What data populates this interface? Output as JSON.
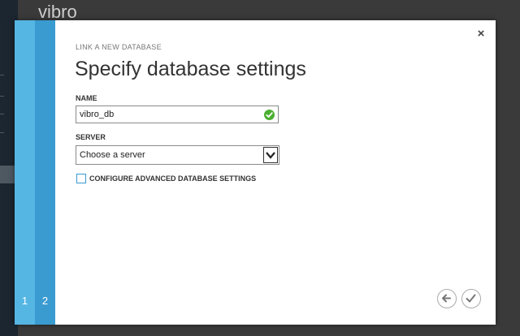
{
  "background": {
    "app_title": "vibro"
  },
  "dialog": {
    "steps": [
      "1",
      "2"
    ],
    "subtitle": "LINK A NEW DATABASE",
    "heading": "Specify database settings",
    "name_label": "NAME",
    "name_value": "vibro_db",
    "server_label": "SERVER",
    "server_value": "Choose a server",
    "advanced_checkbox_label": "CONFIGURE ADVANCED DATABASE SETTINGS",
    "advanced_checked": false,
    "close_glyph": "×"
  },
  "colors": {
    "step1": "#55b6e4",
    "step2": "#3a9bd0",
    "valid": "#4caf32"
  },
  "icons": {
    "close": "close-icon",
    "valid": "check-circle-icon",
    "dropdown": "chevron-down-icon",
    "back": "arrow-left-icon",
    "finish": "checkmark-icon"
  }
}
